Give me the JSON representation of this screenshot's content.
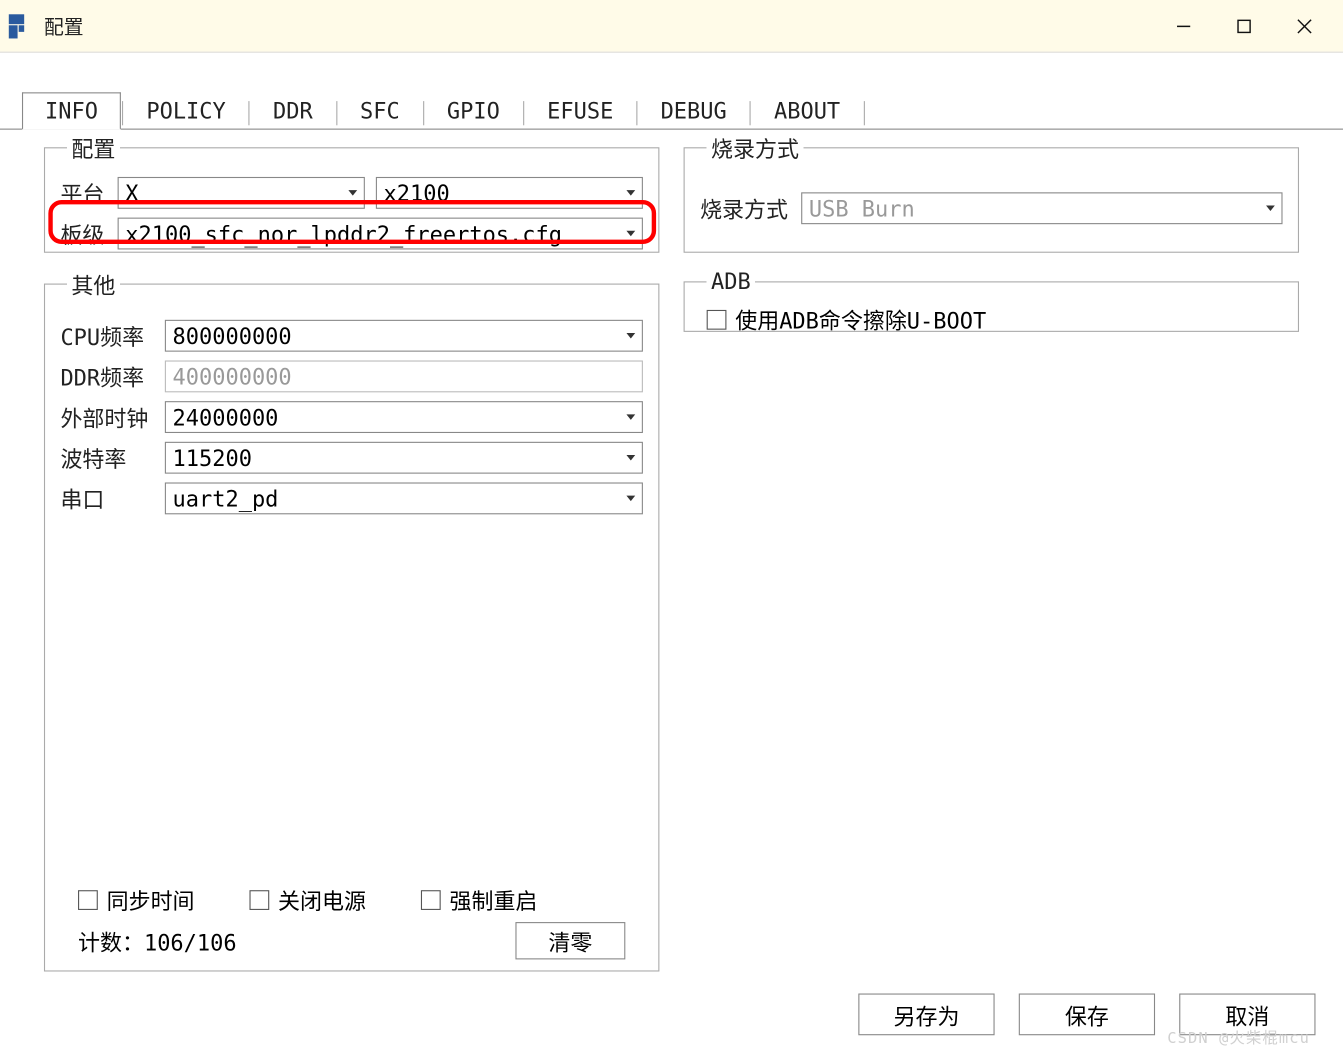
{
  "window": {
    "title": "配置"
  },
  "tabs": [
    "INFO",
    "POLICY",
    "DDR",
    "SFC",
    "GPIO",
    "EFUSE",
    "DEBUG",
    "ABOUT"
  ],
  "group_config": {
    "legend": "配置",
    "platform_label": "平台",
    "platform_value": "X",
    "chip_value": "x2100",
    "board_label": "板级",
    "board_value": "x2100_sfc_nor_lpddr2_freertos.cfg"
  },
  "group_burn": {
    "legend": "烧录方式",
    "label": "烧录方式",
    "value": "USB Burn"
  },
  "group_adb": {
    "legend": "ADB",
    "checkbox_label": "使用ADB命令擦除U-BOOT"
  },
  "group_other": {
    "legend": "其他",
    "cpu_freq_label": "CPU频率",
    "cpu_freq_value": "800000000",
    "ddr_freq_label": "DDR频率",
    "ddr_freq_value": "400000000",
    "ext_clock_label": "外部时钟",
    "ext_clock_value": "24000000",
    "baud_label": "波特率",
    "baud_value": "115200",
    "uart_label": "串口",
    "uart_value": "uart2_pd",
    "sync_time_label": "同步时间",
    "power_off_label": "关闭电源",
    "force_reboot_label": "强制重启",
    "count_label": "计数：106/106",
    "clear_button": "清零"
  },
  "buttons": {
    "save_as": "另存为",
    "save": "保存",
    "cancel": "取消"
  },
  "watermark": "CSDN @火柴棍mcu"
}
